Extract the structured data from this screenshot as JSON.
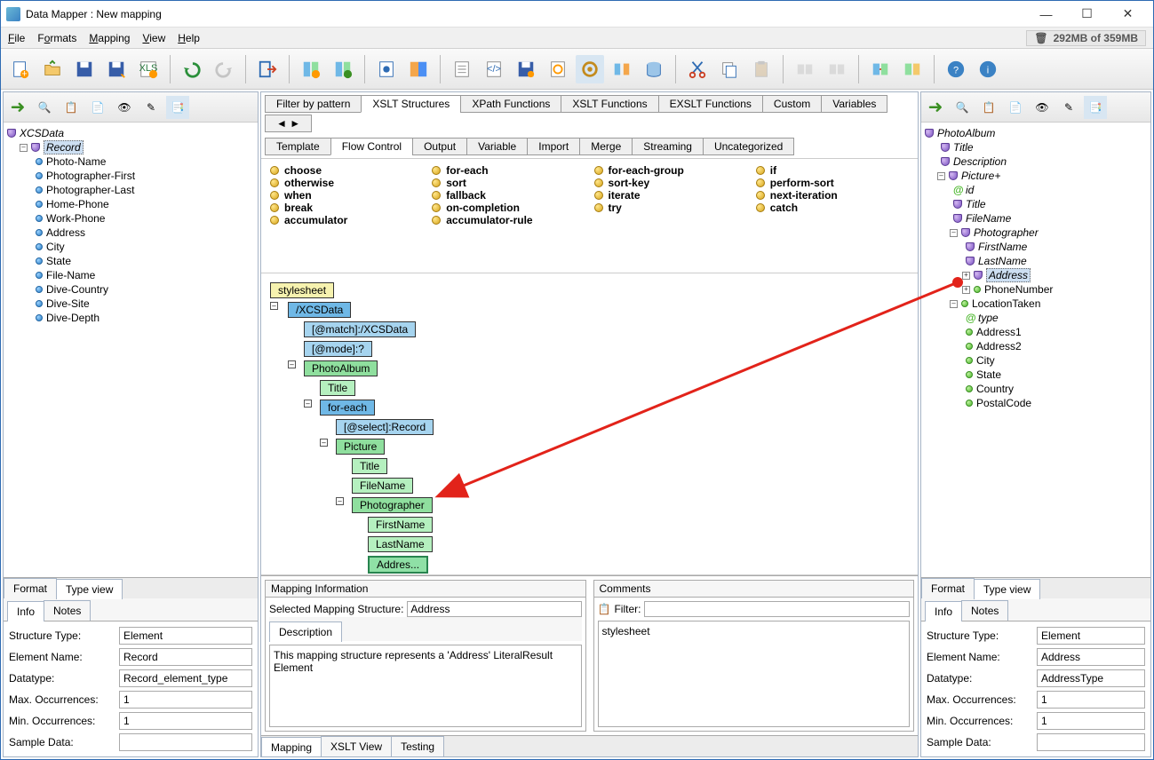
{
  "title": "Data Mapper : New mapping",
  "menus": [
    "File",
    "Formats",
    "Mapping",
    "View",
    "Help"
  ],
  "memory": "292MB of 359MB",
  "leftTree": {
    "root": "XCSData",
    "recordLabel": "Record",
    "items": [
      "Photo-Name",
      "Photographer-First",
      "Photographer-Last",
      "Home-Phone",
      "Work-Phone",
      "Address",
      "City",
      "State",
      "File-Name",
      "Dive-Country",
      "Dive-Site",
      "Dive-Depth"
    ]
  },
  "leftTabs": {
    "format": "Format",
    "typeview": "Type view",
    "info": "Info",
    "notes": "Notes"
  },
  "leftInfo": {
    "labels": {
      "structType": "Structure Type:",
      "elemName": "Element Name:",
      "datatype": "Datatype:",
      "max": "Max. Occurrences:",
      "min": "Min. Occurrences:",
      "sample": "Sample Data:"
    },
    "structType": "Element",
    "elemName": "Record",
    "datatype": "Record_element_type",
    "max": "1",
    "min": "1",
    "sample": ""
  },
  "topTabs": [
    "Filter by pattern",
    "XSLT Structures",
    "XPath Functions",
    "XSLT Functions",
    "EXSLT Functions",
    "Custom",
    "Variables"
  ],
  "activeTopTab": "XSLT Structures",
  "subTabs": [
    "Template",
    "Flow Control",
    "Output",
    "Variable",
    "Import",
    "Merge",
    "Streaming",
    "Uncategorized"
  ],
  "activeSubTab": "Flow Control",
  "flowItems": {
    "col1": [
      "choose",
      "otherwise",
      "when",
      "break",
      "accumulator"
    ],
    "col2": [
      "for-each",
      "sort",
      "fallback",
      "on-completion",
      "accumulator-rule"
    ],
    "col3": [
      "for-each-group",
      "sort-key",
      "iterate",
      "try"
    ],
    "col4": [
      "if",
      "perform-sort",
      "next-iteration",
      "catch"
    ]
  },
  "canvasNodes": {
    "stylesheet": "stylesheet",
    "xcsdata": "/XCSData",
    "match": "[@match]:/XCSData",
    "mode": "[@mode]:?",
    "photoalbum": "PhotoAlbum",
    "title": "Title",
    "foreach": "for-each",
    "select": "[@select]:Record",
    "picture": "Picture",
    "title2": "Title",
    "filename": "FileName",
    "photographer": "Photographer",
    "firstname": "FirstName",
    "lastname": "LastName",
    "address": "Addres..."
  },
  "mapInfo": {
    "title": "Mapping Information",
    "selLabel": "Selected Mapping Structure:",
    "selValue": "Address",
    "descTab": "Description",
    "descText": "This mapping structure represents a 'Address' LiteralResult Element",
    "commentsTitle": "Comments",
    "filterLabel": "Filter:",
    "commentsBody": "stylesheet"
  },
  "bottomTabs": [
    "Mapping",
    "XSLT View",
    "Testing"
  ],
  "rightTree": {
    "root": "PhotoAlbum",
    "title": "Title",
    "desc": "Description",
    "picture": "Picture+",
    "id": "id",
    "ptitle": "Title",
    "filename": "FileName",
    "photographer": "Photographer",
    "firstname": "FirstName",
    "lastname": "LastName",
    "address": "Address",
    "phone": "PhoneNumber",
    "location": "LocationTaken",
    "ltype": "type",
    "addr1": "Address1",
    "addr2": "Address2",
    "city": "City",
    "state": "State",
    "country": "Country",
    "postal": "PostalCode"
  },
  "rightTabs": {
    "format": "Format",
    "typeview": "Type view",
    "info": "Info",
    "notes": "Notes"
  },
  "rightInfo": {
    "labels": {
      "structType": "Structure Type:",
      "elemName": "Element Name:",
      "datatype": "Datatype:",
      "max": "Max. Occurrences:",
      "min": "Min. Occurrences:",
      "sample": "Sample Data:"
    },
    "structType": "Element",
    "elemName": "Address",
    "datatype": "AddressType",
    "max": "1",
    "min": "1",
    "sample": ""
  }
}
